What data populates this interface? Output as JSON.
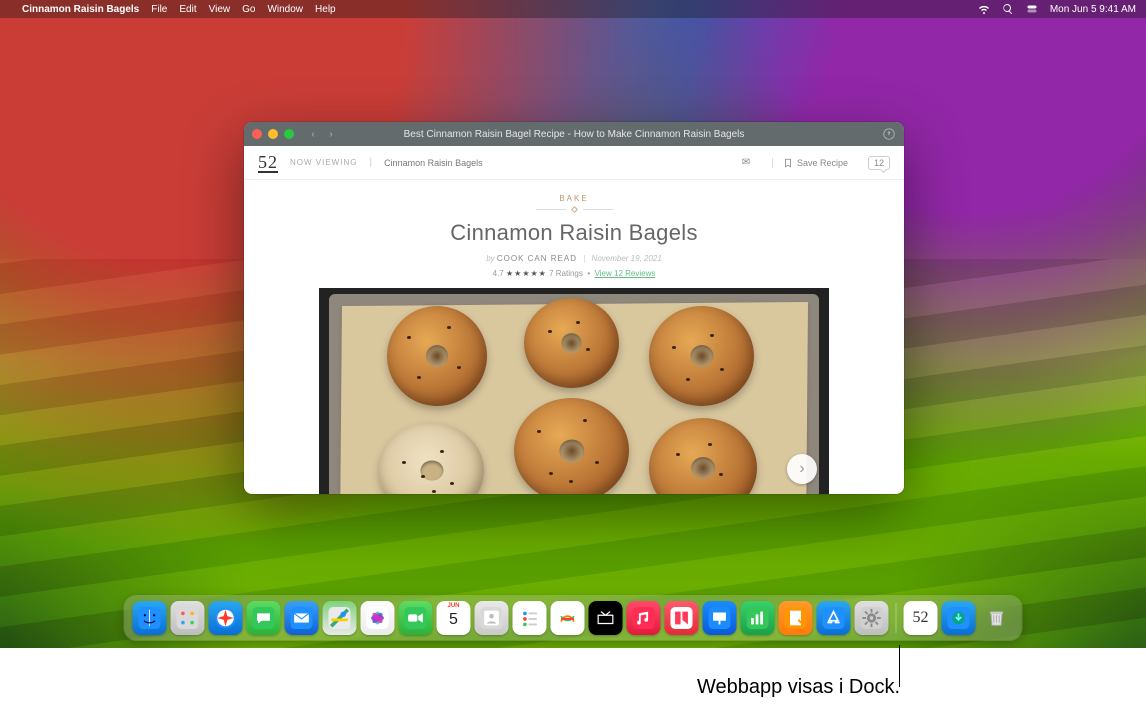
{
  "menubar": {
    "app_name": "Cinnamon Raisin Bagels",
    "items": [
      "File",
      "Edit",
      "View",
      "Go",
      "Window",
      "Help"
    ],
    "datetime": "Mon Jun 5  9:41 AM"
  },
  "window": {
    "title": "Best Cinnamon Raisin Bagel Recipe - How to Make Cinnamon Raisin Bagels"
  },
  "siteheader": {
    "logo": "52",
    "now_viewing_label": "NOW VIEWING",
    "page_name": "Cinnamon Raisin Bagels",
    "save_recipe": "Save Recipe",
    "comment_count": "12"
  },
  "page": {
    "category": "BAKE",
    "title": "Cinnamon Raisin Bagels",
    "byline_by": "by",
    "byline_author": "COOK CAN READ",
    "byline_date": "November 19, 2021",
    "rating_value": "4.7",
    "stars": "★★★★★",
    "rating_count": "7 Ratings",
    "reviews_link": "View 12 Reviews"
  },
  "dock": {
    "items": [
      {
        "name": "finder",
        "color": "linear-gradient(180deg,#2aa7f0,#0a6dd6)"
      },
      {
        "name": "launchpad",
        "color": "linear-gradient(180deg,#e0e0e0,#bdbdbd)"
      },
      {
        "name": "safari",
        "color": "linear-gradient(180deg,#2aa7f0,#0a6dd6)"
      },
      {
        "name": "messages",
        "color": "linear-gradient(180deg,#5ddb63,#2bb23a)"
      },
      {
        "name": "mail",
        "color": "linear-gradient(180deg,#3aa0f6,#1060d6)"
      },
      {
        "name": "maps",
        "color": "linear-gradient(180deg,#7fd27a,#e9e9e9)"
      },
      {
        "name": "photos",
        "color": "linear-gradient(180deg,#ffffff,#eaeaea)"
      },
      {
        "name": "facetime",
        "color": "linear-gradient(180deg,#5ddb63,#2bb23a)"
      },
      {
        "name": "calendar",
        "color": "#ffffff"
      },
      {
        "name": "contacts",
        "color": "linear-gradient(180deg,#e9e9e9,#c9c9c9)"
      },
      {
        "name": "reminders",
        "color": "#ffffff"
      },
      {
        "name": "freeform",
        "color": "#ffffff"
      },
      {
        "name": "tv",
        "color": "#000000"
      },
      {
        "name": "music",
        "color": "linear-gradient(180deg,#ff4a6a,#e21a3a)"
      },
      {
        "name": "news",
        "color": "linear-gradient(180deg,#ff5a6a,#e22a3a)"
      },
      {
        "name": "keynote",
        "color": "linear-gradient(180deg,#1a8cff,#0a5ad6)"
      },
      {
        "name": "numbers",
        "color": "linear-gradient(180deg,#3ad06a,#1aa04a)"
      },
      {
        "name": "pages",
        "color": "linear-gradient(180deg,#ff9a2a,#ff7a0a)"
      },
      {
        "name": "appstore",
        "color": "linear-gradient(180deg,#2aa7f0,#0a6dd6)"
      },
      {
        "name": "settings",
        "color": "linear-gradient(180deg,#e0e0e0,#bdbdbd)"
      }
    ],
    "after_sep": [
      {
        "name": "webapp-52",
        "color": "#ffffff",
        "label": "52"
      },
      {
        "name": "downloads",
        "color": "linear-gradient(180deg,#2aa7f0,#0a6dd6)"
      },
      {
        "name": "trash",
        "color": "linear-gradient(180deg,#e9e9e9,#c9c9c9)"
      }
    ],
    "calendar_day": "5",
    "calendar_month": "JUN"
  },
  "annotation": "Webbapp visas i Dock."
}
